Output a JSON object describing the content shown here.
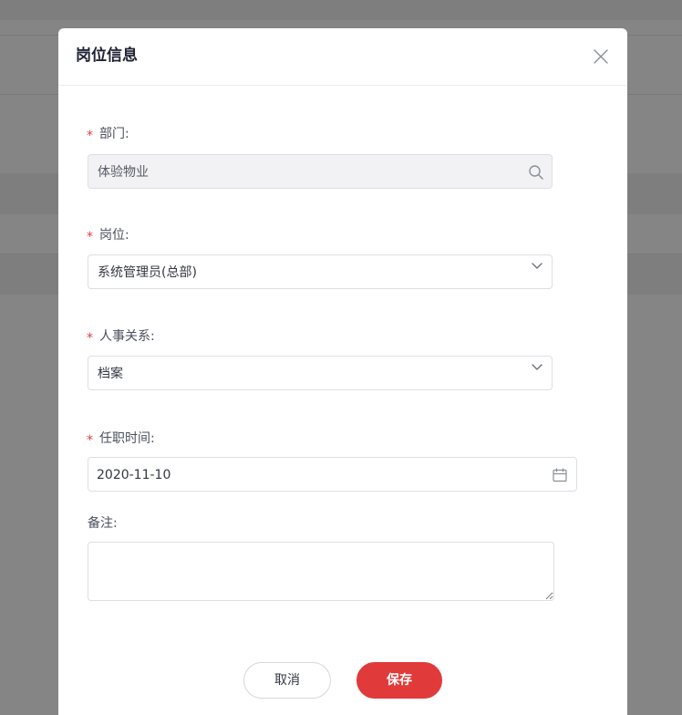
{
  "modal": {
    "title": "岗位信息"
  },
  "form": {
    "department": {
      "label": "部门:",
      "required": true,
      "value": "体验物业",
      "disabled": true,
      "icon": "search-icon"
    },
    "position": {
      "label": "岗位:",
      "required": true,
      "value": "系统管理员(总部)",
      "icon": "chevron-down-icon"
    },
    "personnel_relation": {
      "label": "人事关系:",
      "required": true,
      "value": "档案",
      "icon": "chevron-down-icon"
    },
    "start_date": {
      "label": "任职时间:",
      "required": true,
      "value": "2020-11-10",
      "icon": "calendar-icon"
    },
    "remark": {
      "label": "备注:",
      "required": false,
      "value": ""
    },
    "required_mark": "*"
  },
  "actions": {
    "cancel_label": "取消",
    "save_label": "保存"
  },
  "colors": {
    "accent": "#e03a3a",
    "required": "#e03e3e",
    "overlay": "rgba(0,0,0,0.48)"
  }
}
